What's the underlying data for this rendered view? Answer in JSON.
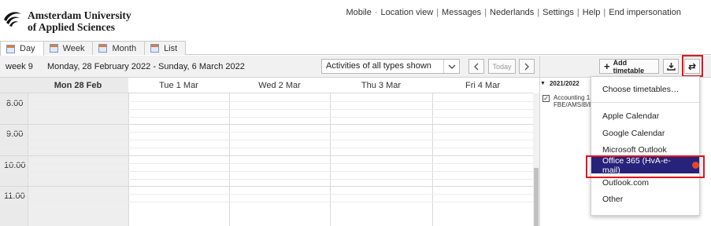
{
  "header": {
    "logo_line1": "Amsterdam University",
    "logo_line2": "of Applied Sciences",
    "links": [
      "Mobile",
      "Location view",
      "Messages",
      "Nederlands",
      "Settings",
      "Help",
      "End impersonation"
    ]
  },
  "tabs": [
    {
      "label": "Day",
      "active": true
    },
    {
      "label": "Week",
      "active": false
    },
    {
      "label": "Month",
      "active": false
    },
    {
      "label": "List",
      "active": false
    }
  ],
  "toolbar": {
    "week": "week 9",
    "date_range": "Monday, 28 February 2022 - Sunday, 6 March 2022",
    "filter": "Activities of all types shown",
    "today": "Today",
    "prev_icon": "chevron-left-icon",
    "next_icon": "chevron-right-icon",
    "add_timetable": "Add timetable"
  },
  "calendar": {
    "days": [
      "Mon 28 Feb",
      "Tue 1 Mar",
      "Wed 2 Mar",
      "Thu 3 Mar",
      "Fri 4 Mar"
    ],
    "times": [
      "8:00",
      "9:00",
      "10:00",
      "11:00"
    ]
  },
  "right_panel": {
    "year": "2021/2022",
    "timetable_line1": "Accounting 1",
    "timetable_line2": "FBE/AMSIB/E",
    "checked": true
  },
  "dropdown": {
    "choose": "Choose timetables…",
    "apple": "Apple Calendar",
    "google": "Google Calendar",
    "microsoft": "Microsoft Outlook",
    "office365": "Office 365 (HvA-e-mail)",
    "outlook_com": "Outlook.com",
    "other": "Other"
  },
  "colors": {
    "highlight_red": "#e4161d",
    "selected_bg": "#27227a"
  }
}
